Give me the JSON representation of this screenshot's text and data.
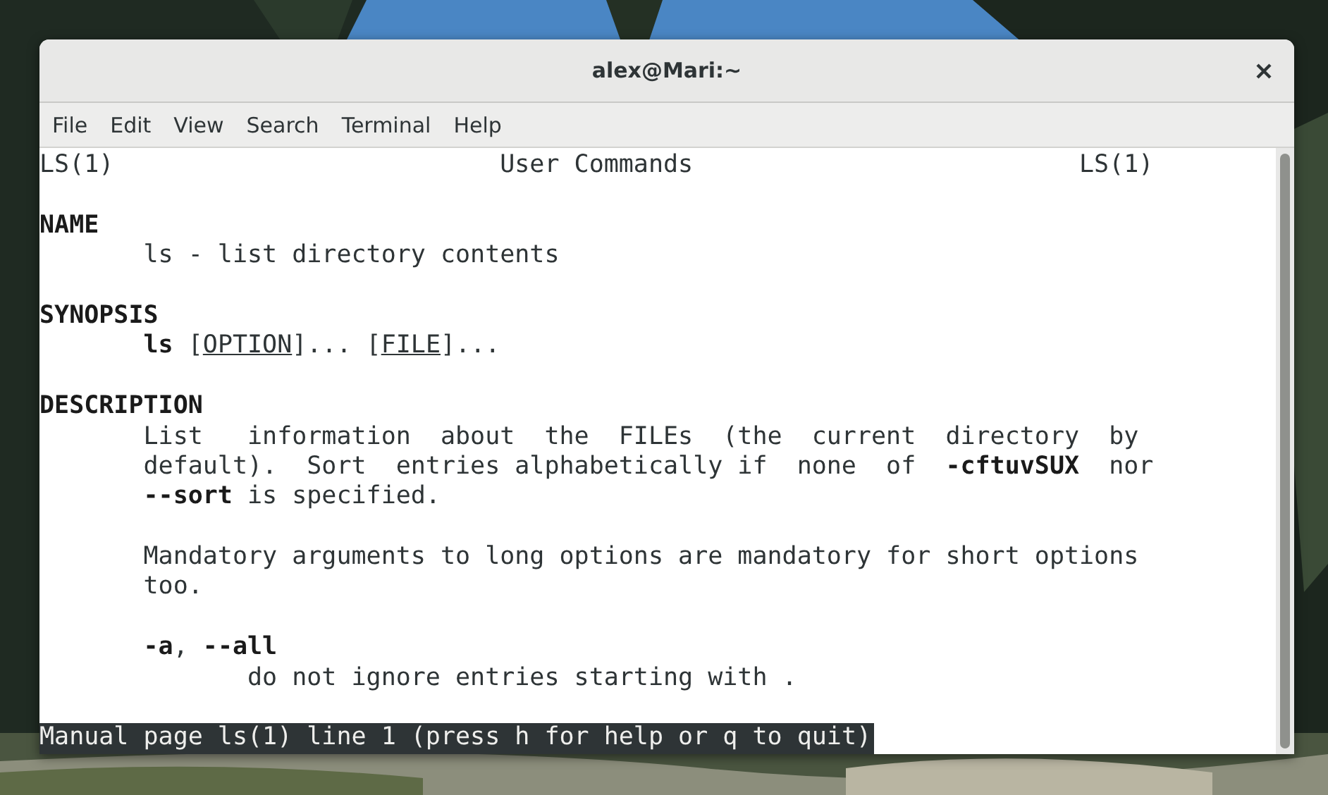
{
  "window": {
    "title": "alex@Mari:~"
  },
  "menu": [
    "File",
    "Edit",
    "View",
    "Search",
    "Terminal",
    "Help"
  ],
  "man_header": {
    "left": "LS(1)",
    "center": "User Commands",
    "right": "LS(1)"
  },
  "lines": [
    {
      "kind": "blank"
    },
    {
      "kind": "heading",
      "segments": [
        {
          "text": "NAME",
          "kind": "bold"
        }
      ]
    },
    {
      "kind": "body",
      "segments": [
        {
          "text": "ls - list directory contents",
          "kind": "plain"
        }
      ]
    },
    {
      "kind": "blank"
    },
    {
      "kind": "heading",
      "segments": [
        {
          "text": "SYNOPSIS",
          "kind": "bold"
        }
      ]
    },
    {
      "kind": "body",
      "segments": [
        {
          "text": "ls",
          "kind": "bold"
        },
        {
          "text": " [",
          "kind": "plain"
        },
        {
          "text": "OPTION",
          "kind": "underline"
        },
        {
          "text": "]... [",
          "kind": "plain"
        },
        {
          "text": "FILE",
          "kind": "underline"
        },
        {
          "text": "]...",
          "kind": "plain"
        }
      ]
    },
    {
      "kind": "blank"
    },
    {
      "kind": "heading",
      "segments": [
        {
          "text": "DESCRIPTION",
          "kind": "bold"
        }
      ]
    },
    {
      "kind": "body",
      "segments": [
        {
          "text": "List   information  about  the  FILEs  (the  current  directory  by",
          "kind": "plain"
        }
      ]
    },
    {
      "kind": "body",
      "segments": [
        {
          "text": "default).  Sort  entries alphabetically if  none  of  ",
          "kind": "plain"
        },
        {
          "text": "-cftuvSUX",
          "kind": "bold"
        },
        {
          "text": "  nor",
          "kind": "plain"
        }
      ]
    },
    {
      "kind": "body",
      "segments": [
        {
          "text": "--sort",
          "kind": "bold"
        },
        {
          "text": " is specified.",
          "kind": "plain"
        }
      ]
    },
    {
      "kind": "blank"
    },
    {
      "kind": "body",
      "segments": [
        {
          "text": "Mandatory arguments to long options are mandatory for short options",
          "kind": "plain"
        }
      ]
    },
    {
      "kind": "body",
      "segments": [
        {
          "text": "too.",
          "kind": "plain"
        }
      ]
    },
    {
      "kind": "blank"
    },
    {
      "kind": "body",
      "segments": [
        {
          "text": "-a",
          "kind": "bold"
        },
        {
          "text": ", ",
          "kind": "plain"
        },
        {
          "text": "--all",
          "kind": "bold"
        }
      ]
    },
    {
      "kind": "option-body",
      "segments": [
        {
          "text": "do not ignore entries starting with .",
          "kind": "plain"
        }
      ]
    },
    {
      "kind": "blank"
    }
  ],
  "status_line": "Manual page ls(1) line 1 (press h for help or q to quit)"
}
